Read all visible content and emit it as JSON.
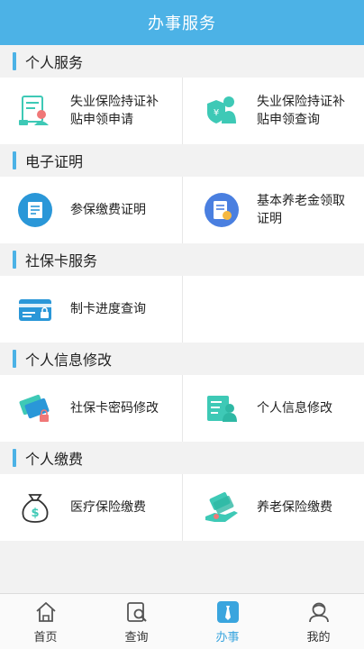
{
  "header": {
    "title": "办事服务"
  },
  "sections": [
    {
      "title": "个人服务",
      "items": [
        {
          "label": "失业保险持证补贴申领申请",
          "icon": "document-person-icon"
        },
        {
          "label": "失业保险持证补贴申领查询",
          "icon": "shield-person-icon"
        }
      ]
    },
    {
      "title": "电子证明",
      "items": [
        {
          "label": "参保缴费证明",
          "icon": "certificate-icon"
        },
        {
          "label": "基本养老金领取证明",
          "icon": "pension-card-icon"
        }
      ]
    },
    {
      "title": "社保卡服务",
      "items": [
        {
          "label": "制卡进度查询",
          "icon": "card-lock-icon"
        }
      ]
    },
    {
      "title": "个人信息修改",
      "items": [
        {
          "label": "社保卡密码修改",
          "icon": "card-password-icon"
        },
        {
          "label": "个人信息修改",
          "icon": "profile-edit-icon"
        }
      ]
    },
    {
      "title": "个人缴费",
      "items": [
        {
          "label": "医疗保险缴费",
          "icon": "money-bag-icon"
        },
        {
          "label": "养老保险缴费",
          "icon": "pension-payment-icon"
        }
      ]
    }
  ],
  "tabbar": {
    "items": [
      {
        "label": "首页",
        "icon": "home-icon"
      },
      {
        "label": "查询",
        "icon": "search-icon"
      },
      {
        "label": "办事",
        "icon": "tie-icon"
      },
      {
        "label": "我的",
        "icon": "user-icon"
      }
    ],
    "active_index": 2
  },
  "colors": {
    "primary": "#4cb2e6",
    "icon_teal": "#3ec9b6",
    "icon_blue": "#2a97d8",
    "active_tab": "#3aa5de"
  }
}
